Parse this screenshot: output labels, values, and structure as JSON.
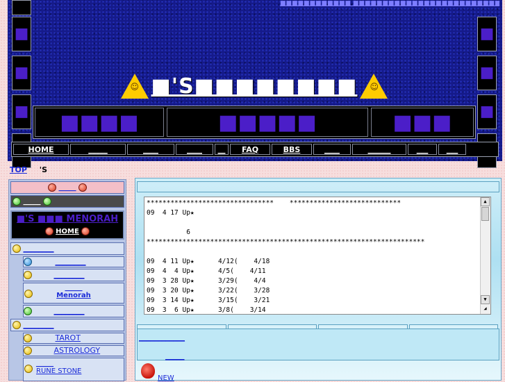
{
  "colors": {
    "banner_bg": "#151a8a",
    "menu_text": "#4b1ec8",
    "link": "#1a2bd8",
    "page_bg": "#f7dede"
  },
  "header": {
    "marquee": "■■■■■■■■■■■■ ■■■■■■■■■■■■■■■■■■■■■■■■■■■■■■■■■■■■■■■■■■■",
    "title": "■'S■■■■■■■■",
    "left_boxes": [
      "■",
      "■",
      "■",
      "■"
    ],
    "right_boxes": [
      "■",
      "■",
      "■",
      "■"
    ],
    "menu_boxes": [
      "■■■■",
      "■■■■■",
      "■■■"
    ]
  },
  "nav": [
    "HOME",
    "_____",
    "____",
    "____",
    "__",
    "FAQ",
    "BBS",
    "____",
    "______",
    "___",
    "___"
  ],
  "breadcrumb": {
    "top": "TOP",
    "current": "'S"
  },
  "sidebar": {
    "section1_header": "_____",
    "section1_sub": "_____",
    "menorah_title": "■'S ■■■ MENORAH",
    "home_link": "HOME",
    "group1_header": "________",
    "group1_items": [
      "________",
      "________",
      "Menorah",
      "________"
    ],
    "group1_item3_top": "_____",
    "group2_header": "________",
    "group2_items": [
      "TAROT",
      "ASTROLOGY",
      "RUNE STONE"
    ],
    "group2_item3_top": "_____"
  },
  "news": {
    "lines": [
      "********************************    ****************************",
      "09  4 17 Up★",
      "",
      "          6",
      "**********************************************************************",
      "",
      "09  4 11 Up★      4/12(    4/18",
      "09  4  4 Up★      4/5(    4/11",
      "09  3 28 Up★      3/29(    4/4",
      "09  3 20 Up★      3/22(    3/28",
      "09  3 14 Up★      3/15(    3/21",
      "09  3  6 Up★      3/8(    3/14"
    ]
  },
  "content_links": {
    "link1": "____________",
    "link2": "_____",
    "new_label": "NEW"
  }
}
